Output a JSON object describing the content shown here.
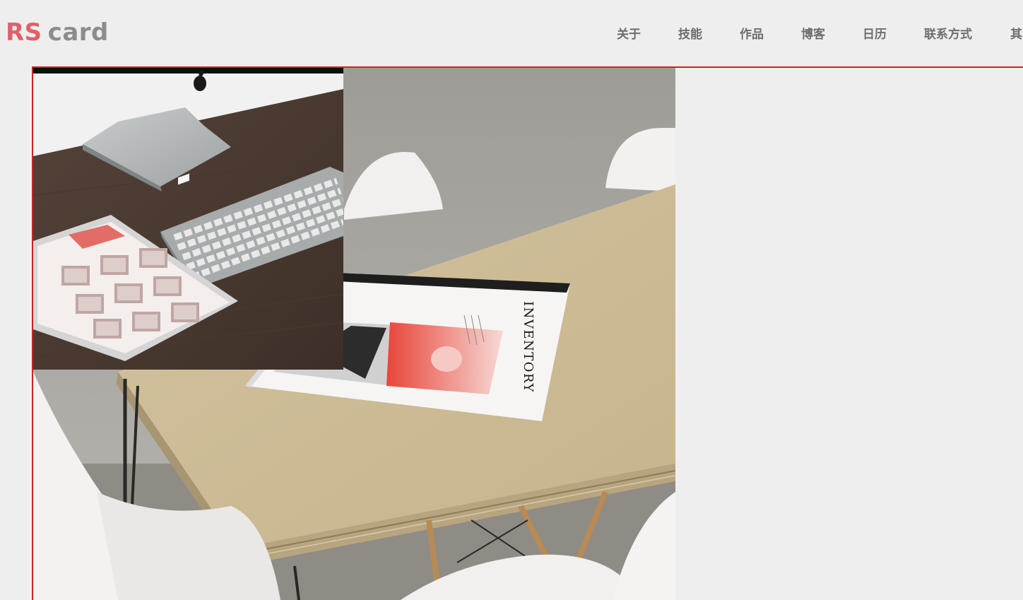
{
  "logo": {
    "part1": "RS",
    "part2": "card"
  },
  "nav": {
    "items": [
      {
        "label": "关于"
      },
      {
        "label": "技能"
      },
      {
        "label": "作品"
      },
      {
        "label": "博客"
      },
      {
        "label": "日历"
      },
      {
        "label": "联系方式"
      },
      {
        "label": "其"
      }
    ]
  },
  "magazine": {
    "title": "INVENTORY"
  },
  "colors": {
    "accent_red": "#e0606a",
    "frame_border": "#cc2222",
    "background": "#eeeeee",
    "nav_text": "#6e6e6e"
  }
}
